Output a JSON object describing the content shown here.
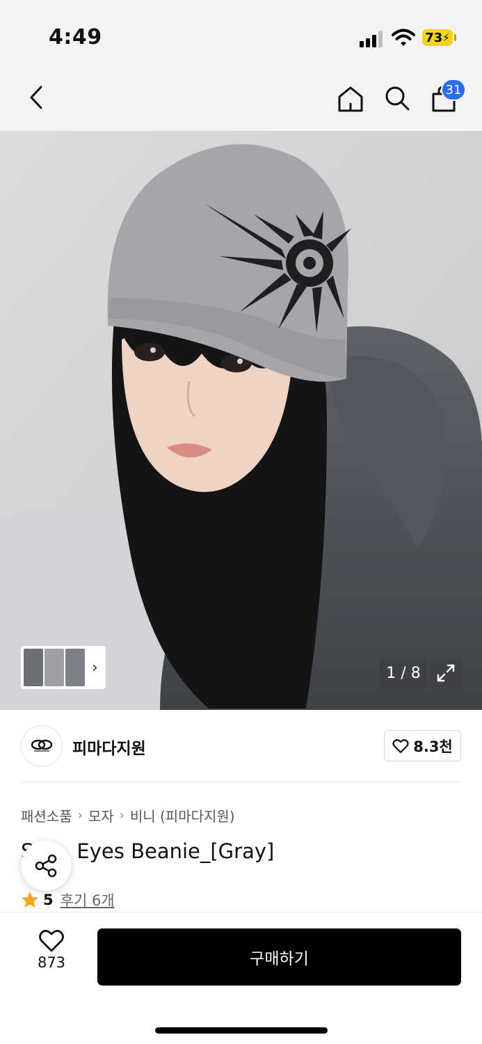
{
  "status_bar": {
    "time": "4:49",
    "battery": "73"
  },
  "nav": {
    "cart_count": "31"
  },
  "gallery": {
    "counter": "1 / 8"
  },
  "brand": {
    "name": "피마다지원",
    "likes": "8.3천"
  },
  "product": {
    "breadcrumb": [
      "패션소품",
      "모자",
      "비니 (피마다지원)"
    ],
    "title_visible": "Eyes Beanie_[Gray]",
    "title_prefix_fragment": "S",
    "rating": "5",
    "reviews": "후기 6개"
  },
  "bottom": {
    "wish_count": "873",
    "buy_label": "구매하기"
  },
  "colors": {
    "badge": "#2a6cf0",
    "battery": "#f4d21e",
    "star": "#f5a623",
    "buy_button": "#000000"
  },
  "icons": [
    "back-icon",
    "home-icon",
    "search-icon",
    "cart-icon",
    "chevron-right-icon",
    "expand-icon",
    "heart-icon",
    "share-icon",
    "star-icon"
  ]
}
